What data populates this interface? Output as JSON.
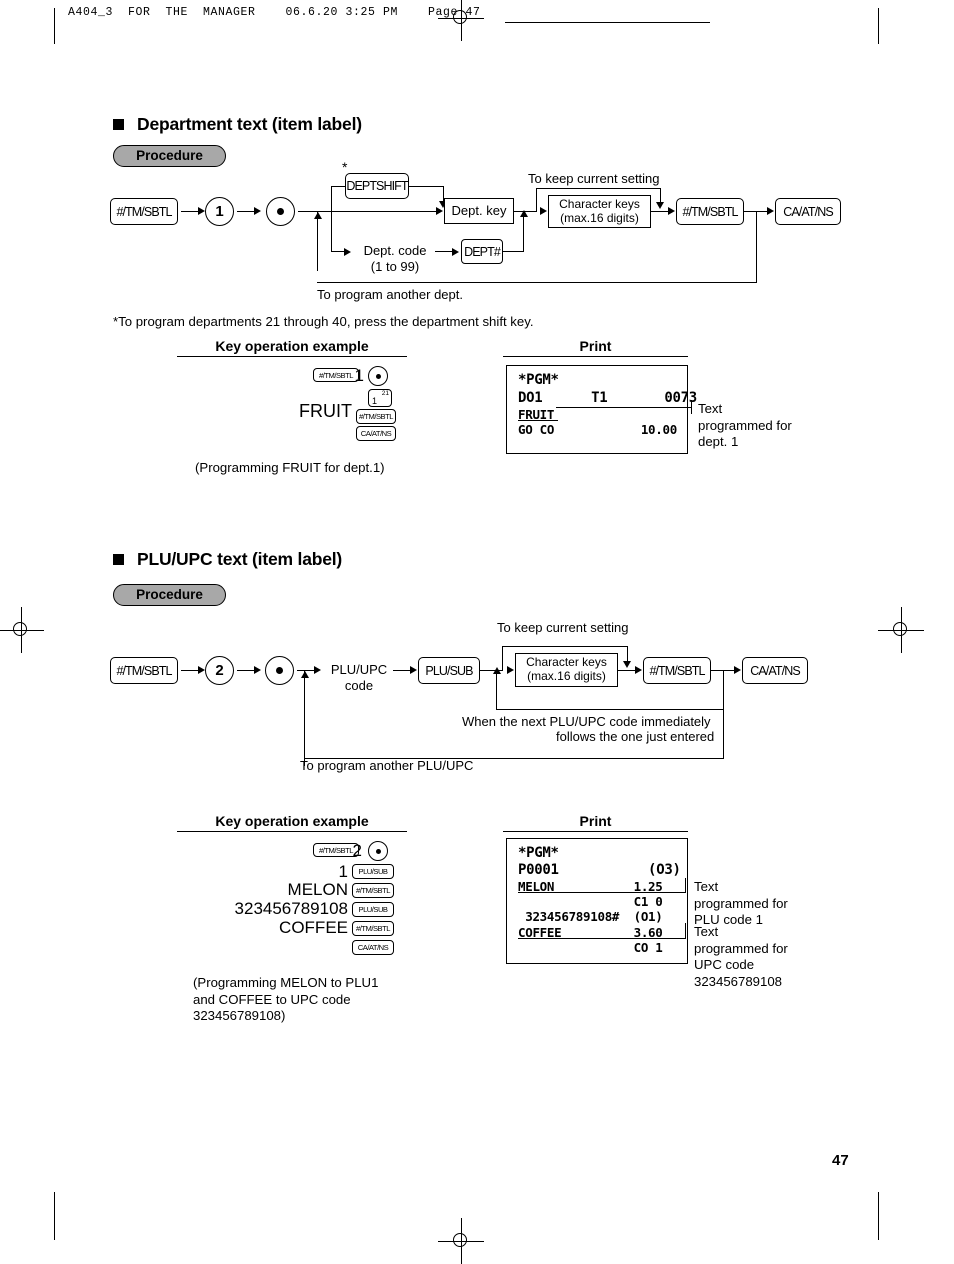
{
  "runhead": "A404_3  FOR  THE  MANAGER    06.6.20 3:25 PM    Page 47",
  "page_number": "47",
  "sections": [
    {
      "title": "Department text (item label)",
      "procedure_label": "Procedure",
      "flow": {
        "start_key": "#/TM/SBTL",
        "mode_number": "1",
        "deptshift_key": "DEPTSHIFT",
        "deptshift_star": "*",
        "dept_key": "Dept. key",
        "dept_code_line1": "Dept. code",
        "dept_code_line2": "(1 to 99)",
        "dept_hash_key": "DEPT#",
        "keep_setting": "To keep current setting",
        "char_keys_line1": "Character keys",
        "char_keys_line2": "(max.16 digits)",
        "end_key1": "#/TM/SBTL",
        "end_key2": "CA/AT/NS",
        "loop_label": "To program another dept."
      },
      "footnote": "*To program departments 21 through 40, press the department shift key.",
      "example_header": "Key operation example",
      "print_header": "Print",
      "example_rows": [
        {
          "text": "",
          "keys": [
            "#/TM/SBTL"
          ],
          "num": "1",
          "dot": true
        },
        {
          "text": "",
          "keys": [
            "dept-1-21"
          ]
        },
        {
          "text": "FRUIT",
          "keys": [
            "#/TM/SBTL"
          ]
        },
        {
          "text": "",
          "keys": [
            "CA/AT/NS"
          ]
        }
      ],
      "dept_key_glyph": {
        "main": "1",
        "sup": "21"
      },
      "caption": "(Programming FRUIT for dept.1)",
      "receipt_lines": [
        "*PGM*",
        "DO1      T1       0073",
        "FRUIT",
        "GO CO            10.00"
      ],
      "callouts": [
        {
          "lines": [
            "Text",
            "programmed for",
            "dept. 1"
          ]
        }
      ]
    },
    {
      "title": "PLU/UPC text (item label)",
      "procedure_label": "Procedure",
      "flow": {
        "start_key": "#/TM/SBTL",
        "mode_number": "2",
        "plu_code_line1": "PLU/UPC",
        "plu_code_line2": "code",
        "plu_sub_key": "PLU/SUB",
        "keep_setting": "To keep current setting",
        "char_keys_line1": "Character keys",
        "char_keys_line2": "(max.16 digits)",
        "end_key1": "#/TM/SBTL",
        "end_key2": "CA/AT/NS",
        "next_note_line1": "When the next PLU/UPC code immediately",
        "next_note_line2": "follows the one just entered",
        "loop_label": "To program another PLU/UPC"
      },
      "example_header": "Key operation example",
      "print_header": "Print",
      "example_rows": [
        {
          "text": "",
          "keys": [
            "#/TM/SBTL"
          ],
          "num": "2",
          "dot": true
        },
        {
          "text": "1",
          "keys": [
            "PLU/SUB"
          ]
        },
        {
          "text": "MELON",
          "keys": [
            "#/TM/SBTL"
          ]
        },
        {
          "text": "323456789108",
          "keys": [
            "PLU/SUB"
          ]
        },
        {
          "text": "COFFEE",
          "keys": [
            "#/TM/SBTL"
          ]
        },
        {
          "text": "",
          "keys": [
            "CA/AT/NS"
          ]
        }
      ],
      "caption_lines": [
        "(Programming MELON to PLU1",
        "and COFFEE to UPC code",
        "323456789108)"
      ],
      "receipt_lines": [
        "*PGM*",
        "P0001           (O3)",
        "MELON           1.25",
        "                C1 0",
        " 323456789108#  (O1)",
        "COFFEE          3.60",
        "                CO 1"
      ],
      "callouts": [
        {
          "lines": [
            "Text",
            "programmed for",
            "PLU code 1"
          ]
        },
        {
          "lines": [
            "Text",
            "programmed for",
            "UPC code",
            "323456789108"
          ]
        }
      ]
    }
  ]
}
